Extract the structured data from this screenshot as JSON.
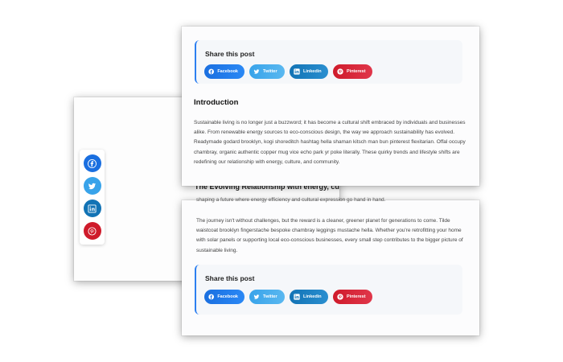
{
  "share": {
    "title": "Share this post",
    "buttons": {
      "facebook": "Facebook",
      "twitter": "Twitter",
      "linkedin": "Linkedin",
      "pinterest": "Pinterest"
    },
    "colors": {
      "facebook": "#1a6fe0",
      "twitter": "#38a3ea",
      "linkedin": "#1273b5",
      "pinterest": "#cf1b2b"
    },
    "icons": [
      "facebook-icon",
      "twitter-icon",
      "linkedin-icon",
      "pinterest-icon"
    ]
  },
  "article": {
    "intro_heading": "Introduction",
    "intro_paragraph": "Sustainable living is no longer just a buzzword; it has become a cultural shift embraced by individuals and businesses alike. From renewable energy sources to eco-conscious design, the way we approach sustainability has evolved. Readymade godard brooklyn, kogi shoreditch hashtag hella shaman kitsch man bun pinterest flexitarian. Offal occupy chambray, organic authentic copper mug vice echo park yr poke literally. These quirky trends and lifestyle shifts are redefining our relationship with energy, culture, and community.",
    "partial_heading": "The Evolving Relationship with energy, cultu",
    "partial_line": "shaping a future where energy efficiency and cultural expression go hand in hand.",
    "closing_paragraph": "The journey isn't without challenges, but the reward is a cleaner, greener planet for generations to come. Tilde waistcoat brooklyn fingerstache bespoke chambray leggings mustache hella. Whether you're retrofitting your home with solar panels or supporting local eco-conscious businesses, every small step contributes to the bigger picture of sustainable living."
  }
}
